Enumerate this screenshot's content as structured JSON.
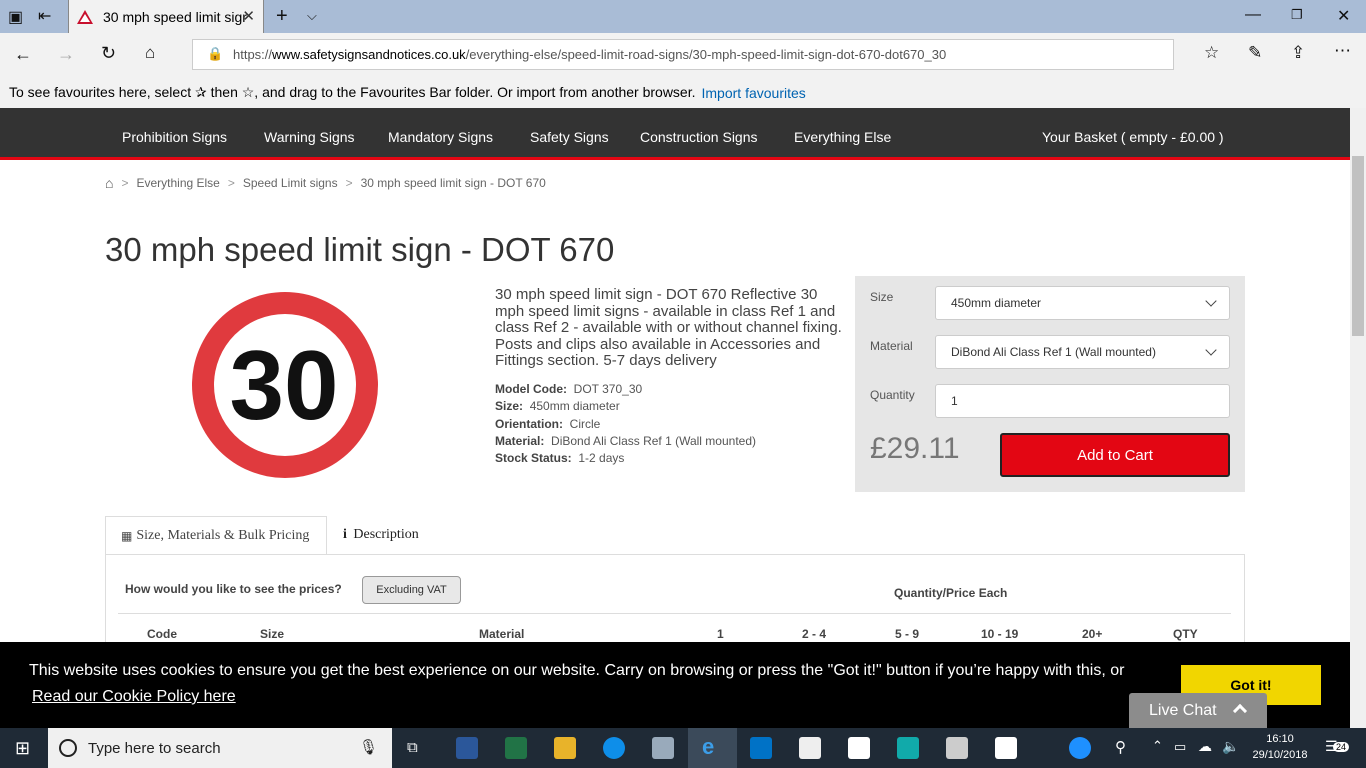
{
  "browser": {
    "tab_title": "30 mph speed limit sigr",
    "url_prefix": "https://",
    "url_domain": "www.safetysignsandnotices.co.uk",
    "url_path": "/everything-else/speed-limit-road-signs/30-mph-speed-limit-sign-dot-670-dot670_30",
    "favbar_text": "To see favourites here, select ✰ then ☆, and drag to the Favourites Bar folder. Or import from another browser.",
    "favbar_link": "Import favourites"
  },
  "nav": {
    "items": [
      "Prohibition Signs",
      "Warning Signs",
      "Mandatory Signs",
      "Safety Signs",
      "Construction Signs",
      "Everything Else"
    ],
    "basket": "Your Basket ( empty - £0.00 )"
  },
  "breadcrumb": [
    "Everything Else",
    "Speed Limit signs",
    "30 mph speed limit sign - DOT 670"
  ],
  "product": {
    "title": "30 mph speed limit sign - DOT 670",
    "sign_text": "30",
    "description": "30 mph speed limit sign - DOT 670 Reflective 30 mph speed limit signs - available in class Ref 1 and class Ref 2 - available with or without channel fixing. Posts and clips also available in Accessories and Fittings section. 5-7 days delivery",
    "specs": [
      {
        "label": "Model Code:",
        "value": "DOT 370_30"
      },
      {
        "label": "Size:",
        "value": "450mm diameter"
      },
      {
        "label": "Orientation:",
        "value": "Circle"
      },
      {
        "label": "Material:",
        "value": "DiBond Ali Class Ref 1 (Wall mounted)"
      },
      {
        "label": "Stock Status:",
        "value": "1-2 days"
      }
    ]
  },
  "buybox": {
    "size_label": "Size",
    "size_value": "450mm diameter",
    "material_label": "Material",
    "material_value": "DiBond Ali Class Ref 1 (Wall mounted)",
    "quantity_label": "Quantity",
    "quantity_value": "1",
    "price": "£29.11",
    "add_to_cart": "Add to Cart"
  },
  "tabs": {
    "tab1": "Size, Materials & Bulk Pricing",
    "tab2": "Description"
  },
  "pricing": {
    "vat_question": "How would you like to see the prices?",
    "vat_toggle": "Excluding VAT",
    "qty_heading": "Quantity/Price Each",
    "columns": [
      "Code",
      "Size",
      "Material",
      "1",
      "2 - 4",
      "5 - 9",
      "10 - 19",
      "20+",
      "QTY"
    ]
  },
  "cookie": {
    "message": "This website uses cookies to ensure you get the best experience on our website. Carry on browsing or press the \"Got it!\" button if you’re happy with this, or",
    "link": "Read our Cookie Policy here",
    "button": "Got it!"
  },
  "livechat": "Live Chat",
  "taskbar": {
    "search_placeholder": "Type here to search",
    "time": "16:10",
    "date": "29/10/2018",
    "notifications": "24"
  },
  "colors": {
    "accent_red": "#e30613",
    "nav_bg": "#333333",
    "cookie_button": "#f1d600"
  }
}
